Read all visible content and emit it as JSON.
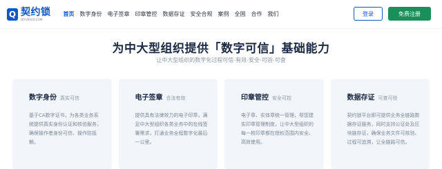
{
  "brand": {
    "name": "契约锁",
    "sub": "QIYUESUO.COM",
    "mark": "Q"
  },
  "menu": [
    "首页",
    "数字身份",
    "电子签章",
    "印章管控",
    "数据存证",
    "安全合规",
    "案例",
    "全国",
    "合作",
    "我们"
  ],
  "actions": {
    "login": "登录",
    "register": "免费注册"
  },
  "hero": {
    "title": "为中大型组织提供「数字可信」基础能力",
    "subtitle": "让中大型组织的数字化过程可信-有效-安全-可验-可查"
  },
  "cards": [
    {
      "title": "数字身份",
      "tag": "真实可信",
      "desc": "基于CA数字证书，为各类业务系统提供真实身份认证和核验服务，确保操作者身份可信、操作防抵赖。"
    },
    {
      "title": "电子签章",
      "tag": "合法有效",
      "desc": "提供具有法律效力的电子印章，满足中大型组织各类业务中的在线签署需求，打通业务全程数字化最后一公里。"
    },
    {
      "title": "印章管控",
      "tag": "安全可控",
      "desc": "电子章、实体章统一管理，帮您建实印章管理制度，让中大型组织的每一枚印章都在授权范围内安全、高效使用。"
    },
    {
      "title": "数据存证",
      "tag": "可查可验",
      "desc": "契约锁平台即可提供业务全链路数据存证服务，同时支持公证处及区块链存证，确保业务文件可核验、过程可追溯，让全链路可信。"
    }
  ],
  "colors": {
    "brand_blue": "#0e57c9",
    "register_green": "#1a8f5a",
    "card_bg": "#f2f5f9"
  }
}
